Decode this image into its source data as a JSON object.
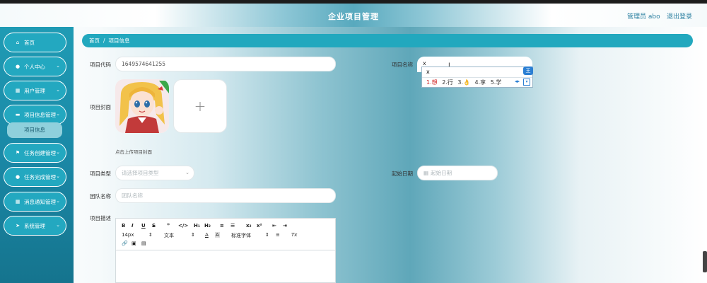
{
  "header": {
    "title": "企业项目管理",
    "admin": "管理员 abo",
    "logout": "退出登录"
  },
  "sidebar": {
    "items": [
      {
        "label": "首页",
        "icon": "home-icon",
        "glyph": "⌂"
      },
      {
        "label": "个人中心",
        "icon": "person-icon",
        "glyph": "●"
      },
      {
        "label": "用户管理",
        "icon": "grid-icon",
        "glyph": "▦"
      },
      {
        "label": "项目信息管理",
        "icon": "folder-icon",
        "glyph": "▬"
      },
      {
        "label": "任务创建管理",
        "icon": "flag-icon",
        "glyph": "⚑"
      },
      {
        "label": "任务完成管理",
        "icon": "person-icon",
        "glyph": "●"
      },
      {
        "label": "消息通知管理",
        "icon": "grid-icon",
        "glyph": "▦"
      },
      {
        "label": "系统管理",
        "icon": "send-icon",
        "glyph": "➤"
      }
    ],
    "submenu": {
      "label": "项目信息"
    }
  },
  "breadcrumb": {
    "home": "首页",
    "separator": "/",
    "current": "项目信息"
  },
  "form": {
    "project_code": {
      "label": "项目代码",
      "value": "1649574641255"
    },
    "project_name": {
      "label": "项目名称",
      "value": "x"
    },
    "cover": {
      "label": "项目封面",
      "hint": "点击上传项目封面",
      "add_glyph": "+"
    },
    "project_type": {
      "label": "项目类型",
      "placeholder": "请选择项目类型"
    },
    "start_date": {
      "label": "起始日期",
      "placeholder": "起始日期"
    },
    "team_name": {
      "label": "团队名称",
      "placeholder": "团队名称"
    },
    "description": {
      "label": "项目描述"
    }
  },
  "editor": {
    "toolbar_row1": [
      "B",
      "I",
      "U",
      "S",
      "❞",
      "</>",
      "H₁",
      "H₂",
      "≡",
      "☰",
      "x₂",
      "x²",
      "⇤",
      "⇥"
    ],
    "font_size": "14px",
    "text_style": "文本",
    "font_family": "标准字体",
    "toolbar_row2_icons": [
      "A",
      "A",
      "≡",
      "Tx"
    ],
    "toolbar_row3_icons": [
      "🔗",
      "▣",
      "▤"
    ]
  },
  "ime": {
    "composition": "x",
    "candidates": [
      "1.想",
      "2.行",
      "3.👌",
      "4.享",
      "5.学"
    ],
    "logo": "王",
    "nav": "◂▸",
    "menu": "▾"
  }
}
